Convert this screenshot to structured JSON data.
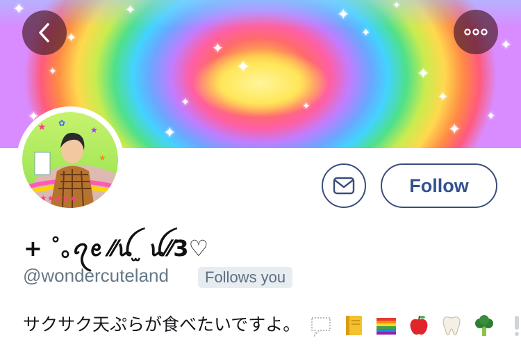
{
  "header": {
    "back_icon": "chevron-left-icon",
    "more_icon": "more-horizontal-icon"
  },
  "banner": {
    "description_icon": "rainbow-heart-banner"
  },
  "profile": {
    "avatar_icon": "avatar",
    "display_name": "+ ˚｡ꪖꫀ ⁄⁄ꪊ ̫ ꪊ⁄⁄3♡",
    "handle": "@wondercuteland",
    "follows_you_label": "Follows you",
    "bio_text": "サクサク天ぷらが食べたいですよ。",
    "bio_emojis": [
      "speech-bubble-icon",
      "notebook-icon",
      "rainbow-flag-icon",
      "apple-icon",
      "tooth-icon",
      "broccoli-icon",
      "exclamation-icon"
    ]
  },
  "actions": {
    "message_icon": "mail-icon",
    "follow_label": "Follow"
  },
  "colors": {
    "accent": "#34508e",
    "secondary_text": "#657786",
    "badge_bg": "#e6ecf0"
  }
}
